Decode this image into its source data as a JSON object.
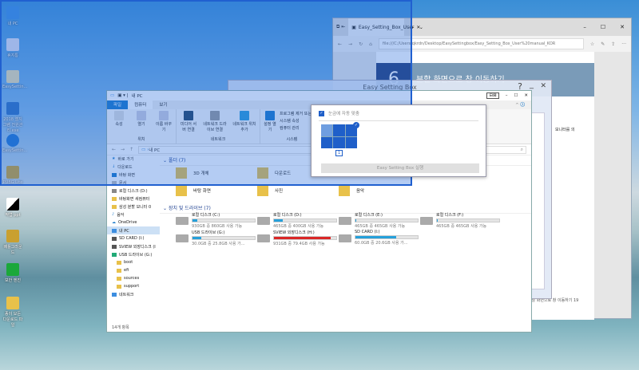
{
  "desktop": {
    "icons": [
      "내 PC",
      "휴지통",
      "EasySettin...",
      "2018 엘지그램 전원관리.exe",
      "EasySettin...",
      "PUBG Lite",
      "작업 ppt",
      "배틀그라운드",
      "보안 엔진",
      "종이 모든 다운로드 파일"
    ]
  },
  "browser": {
    "tab_title": "Easy_Setting_Box_User",
    "new_tab": "+",
    "address": "file:///C:/Users/qkrdn/Desktop/EasySettingbox/Easy_Setting_Box_User%20manual_KOR",
    "heading_number": "6",
    "heading": "분할 화면으로 창 이동하기",
    "side_text": "모니터를 의",
    "footer": "분할 화면으로 창 이동하기   19"
  },
  "easy_setting_box": {
    "title": "Easy Setting Box",
    "help": "?",
    "minimize": "_",
    "close": "✕"
  },
  "explorer": {
    "title": "내 PC",
    "ribbon_tabs": [
      "파일",
      "컴퓨터",
      "보기"
    ],
    "ribbon_location": {
      "label": "위치",
      "buttons": [
        "속성",
        "열기",
        "이름 바꾸기"
      ]
    },
    "ribbon_network": {
      "label": "네트워크",
      "buttons": [
        "미디어 서버 연결",
        "네트워크 드라이브 연결",
        "네트워크 위치 추가"
      ]
    },
    "ribbon_system": {
      "label": "시스템",
      "settings": "설정 열기",
      "items": [
        "프로그램 제거 또는 변경",
        "시스템 속성",
        "컴퓨터 관리"
      ]
    },
    "breadcrumb": "내 PC",
    "sidebar": [
      "바로 가기",
      "다운로드",
      "바탕 화면",
      "문서",
      "로컬 디스크 (D:)",
      "바탕화면 새컴퓨터",
      "삼성 분할 모니터 0",
      "음악",
      "OneDrive",
      "내 PC",
      "SD CARD (I:)",
      "SVIEW 외장디스크 (I",
      "USB 드라이브 (G:)",
      "boot",
      "efi",
      "sources",
      "support",
      "네트워크"
    ],
    "folders_header": "폴더 (7)",
    "folders": [
      "3D 개체",
      "다운로드",
      "바탕 화면",
      "사진",
      "음악"
    ],
    "drives_header": "장치 및 드라이브 (7)",
    "drives": [
      {
        "name": "로컬 디스크 (C:)",
        "info": "930GB 중 860GB 사용 가능",
        "used": 0.08
      },
      {
        "name": "로컬 디스크 (D:)",
        "info": "465GB 중 400GB 사용 가능",
        "used": 0.14
      },
      {
        "name": "로컬 디스크 (E:)",
        "info": "465GB 중 465GB 사용 가능",
        "used": 0.01
      },
      {
        "name": "로컬 디스크 (F:)",
        "info": "465GB 중 465GB 사용 가능",
        "used": 0.01
      },
      {
        "name": "USB 드라이브 (G:)",
        "info": "30.0GB 중 25.8GB 사용 가...",
        "used": 0.14
      },
      {
        "name": "SVIEW 외장디스크 (H:)",
        "info": "931GB 중 79.4GB 사용 가능",
        "used": 0.91
      },
      {
        "name": "SD CARD (I:)",
        "info": "60.0GB 중 20.6GB 사용 가...",
        "used": 0.66
      }
    ],
    "status": "14개 항목"
  },
  "popup": {
    "checkbox_label": "눈금에 자동 맞춤",
    "monitor": "1",
    "run_button": "Easy Setting Box 실행"
  }
}
